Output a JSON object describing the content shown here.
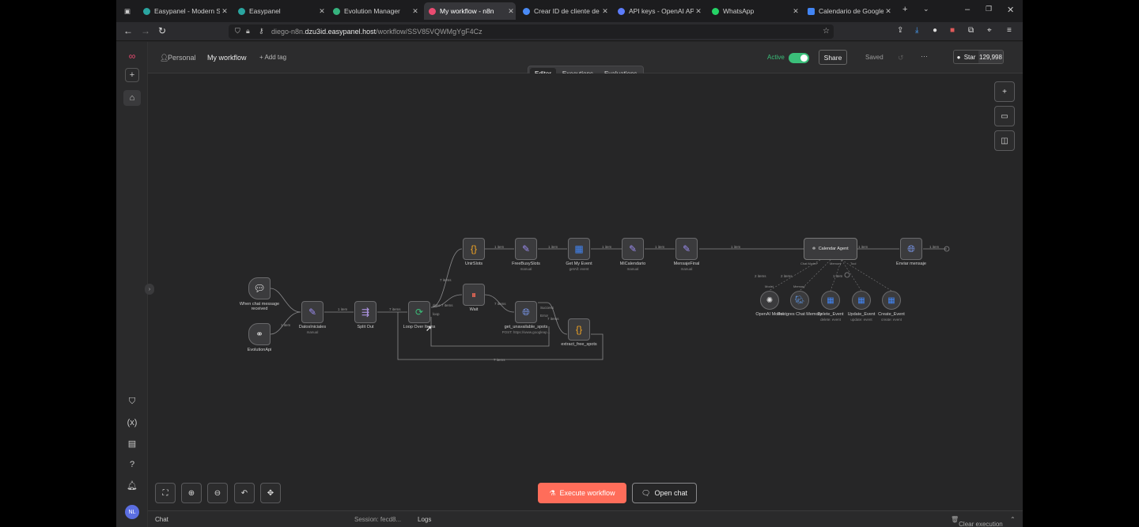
{
  "browser": {
    "tabs": [
      {
        "title": "Easypanel - Modern Serve",
        "color": "#2aa5a0"
      },
      {
        "title": "Easypanel",
        "color": "#2aa5a0"
      },
      {
        "title": "Evolution Manager",
        "color": "#36b37e"
      },
      {
        "title": "My workflow - n8n",
        "color": "#ea4b71"
      },
      {
        "title": "Crear ID de cliente de OA",
        "color": "#4a8af4"
      },
      {
        "title": "API keys - OpenAI API",
        "color": "#5c7cfa"
      },
      {
        "title": "WhatsApp",
        "color": "#25d366"
      },
      {
        "title": "Calendario de Google - a",
        "color": "#4285f4"
      }
    ],
    "url_host": "diego-n8n.",
    "url_domain": "dzu3id.easypanel.host",
    "url_path": "/workflow/SSV85VQWMgYgF4Cz"
  },
  "header": {
    "project": "Personal",
    "workflow_name": "My workflow",
    "add_tag": "+ Add tag",
    "active_label": "Active",
    "share_label": "Share",
    "saved_label": "Saved",
    "more_label": "···",
    "star_label": "Star",
    "star_count": "129,998"
  },
  "view_tabs": [
    "Editor",
    "Executions",
    "Evaluations"
  ],
  "nodes": {
    "chat_trigger": {
      "label": "When chat message received"
    },
    "evolution_api": {
      "label": "EvolutionApi"
    },
    "datos_iniciales": {
      "label": "DatosIniciales",
      "sub": "manual"
    },
    "split_out": {
      "label": "Split Out"
    },
    "loop_over_items": {
      "label": "Loop Over Items"
    },
    "wait": {
      "label": "Wait"
    },
    "get_unavailable_spots": {
      "label": "get_unavailable_spots",
      "sub": "POST: https://www.googleap..."
    },
    "extract_free_spots": {
      "label": "extract_free_spots"
    },
    "unir_slots": {
      "label": "UnirSlots"
    },
    "free_busy_slots": {
      "label": "FreeBusySlots",
      "sub": "manual"
    },
    "get_my_event": {
      "label": "Get My Event",
      "sub": "getAll: event"
    },
    "mi_calendario": {
      "label": "MiCalendario",
      "sub": "manual"
    },
    "mensaje_final": {
      "label": "MensajeFinal",
      "sub": "manual"
    },
    "calendar_agent": {
      "label": "Calendar Agent"
    },
    "enviar_mensaje": {
      "label": "Enviar mensaje"
    },
    "openai_model": {
      "label": "OpenAI Model"
    },
    "postgres_memory": {
      "label": "Postgres Chat Memory"
    },
    "delete_event": {
      "label": "Delete_Event",
      "sub": "delete: event"
    },
    "update_event": {
      "label": "Update_Event",
      "sub": "update: event"
    },
    "create_event": {
      "label": "Create_Event",
      "sub": "create: event"
    }
  },
  "edge_labels": {
    "one_item": "1 item",
    "two_items": "2 items",
    "seven_items": "7 items",
    "done": "done",
    "loop": "loop",
    "success": "Success",
    "error": "Error",
    "chat_model": "Chat Model*",
    "memory": "Memory",
    "tool": "Tool",
    "model": "Model"
  },
  "actions": {
    "execute": "Execute workflow",
    "open_chat": "Open chat"
  },
  "footer": {
    "chat": "Chat",
    "session": "Session: fecd8...",
    "logs": "Logs",
    "clear": "Clear execution"
  },
  "user": {
    "initials": "NL"
  },
  "colors": {
    "accent": "#ff6d5a",
    "active": "#3bbf7a",
    "canvas": "#262627"
  }
}
